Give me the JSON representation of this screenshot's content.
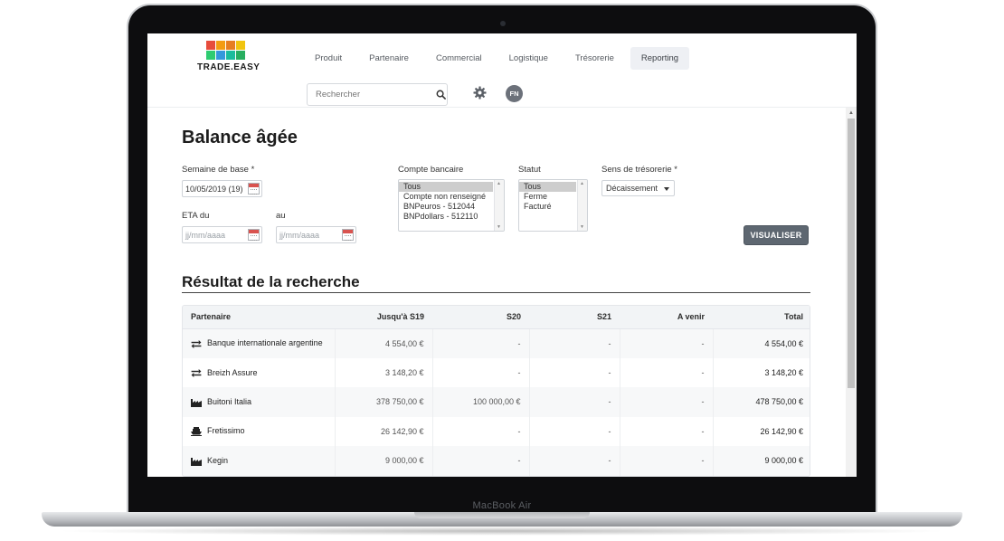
{
  "device": {
    "label": "MacBook Air"
  },
  "app": {
    "logo_text": "TRADE.EASY",
    "logo_colors": [
      "#e74c3c",
      "#f39c12",
      "#e67e22",
      "#f1c40f",
      "#2ecc71",
      "#3498db",
      "#1abc9c",
      "#27ae60"
    ]
  },
  "nav": {
    "items": [
      {
        "label": "Produit"
      },
      {
        "label": "Partenaire"
      },
      {
        "label": "Commercial"
      },
      {
        "label": "Logistique"
      },
      {
        "label": "Trésorerie"
      },
      {
        "label": "Reporting"
      }
    ],
    "active": "Reporting"
  },
  "search": {
    "placeholder": "Rechercher",
    "value": "",
    "icon": "search-icon"
  },
  "settings": {
    "icon": "gear-icon"
  },
  "user": {
    "initials": "FN"
  },
  "page": {
    "title": "Balance âgée"
  },
  "form": {
    "semaine_label": "Semaine de base *",
    "semaine_value": "10/05/2019 (19)",
    "eta_du_label": "ETA du",
    "eta_du_placeholder": "jj/mm/aaaa",
    "eta_au_label": "au",
    "eta_au_placeholder": "jj/mm/aaaa",
    "compte_label": "Compte bancaire",
    "compte_options": [
      "Tous",
      "Compte non renseigné",
      "BNPeuros - 512044",
      "BNPdollars - 512110"
    ],
    "compte_selected": "Tous",
    "statut_label": "Statut",
    "statut_options": [
      "Tous",
      "Ferme",
      "Facturé"
    ],
    "statut_selected": "Tous",
    "sens_label": "Sens de trésorerie *",
    "sens_value": "Décaissement",
    "submit_label": "VISUALISER"
  },
  "results": {
    "title": "Résultat de la recherche",
    "columns": [
      "Partenaire",
      "Jusqu'à S19",
      "S20",
      "S21",
      "A venir",
      "Total"
    ],
    "rows": [
      {
        "type_icon": "transfer-icon",
        "partenaire": "Banque internationale argentine",
        "jusqua_s19": "4 554,00 €",
        "s20": "-",
        "s21": "-",
        "a_venir": "-",
        "total": "4 554,00 €"
      },
      {
        "type_icon": "transfer-icon",
        "partenaire": "Breizh Assure",
        "jusqua_s19": "3 148,20 €",
        "s20": "-",
        "s21": "-",
        "a_venir": "-",
        "total": "3 148,20 €"
      },
      {
        "type_icon": "factory-icon",
        "partenaire": "Buitoni Italia",
        "jusqua_s19": "378 750,00 €",
        "s20": "100 000,00 €",
        "s21": "-",
        "a_venir": "-",
        "total": "478 750,00 €"
      },
      {
        "type_icon": "ship-icon",
        "partenaire": "Fretissimo",
        "jusqua_s19": "26 142,90 €",
        "s20": "-",
        "s21": "-",
        "a_venir": "-",
        "total": "26 142,90 €"
      },
      {
        "type_icon": "factory-icon",
        "partenaire": "Kegin",
        "jusqua_s19": "9 000,00 €",
        "s20": "-",
        "s21": "-",
        "a_venir": "-",
        "total": "9 000,00 €"
      }
    ]
  }
}
